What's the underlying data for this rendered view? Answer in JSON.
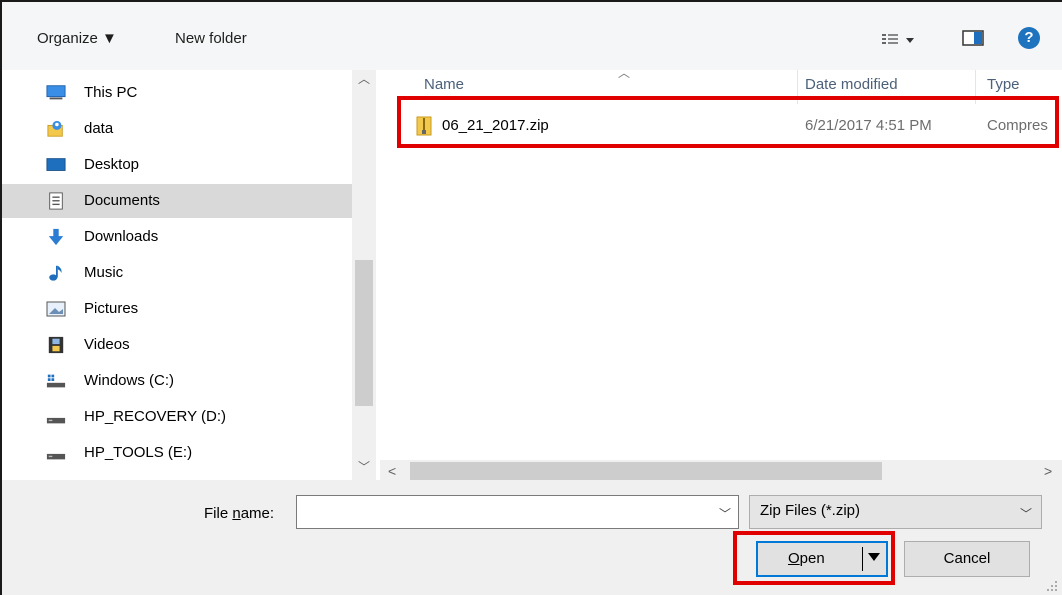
{
  "toolbar": {
    "organize_label": "Organize ▼",
    "new_folder_label": "New folder",
    "view_icon": "view-options-icon",
    "preview_icon": "preview-pane-icon",
    "help_icon": "help-icon",
    "help_glyph": "?"
  },
  "nav": {
    "items": [
      {
        "label": "This PC",
        "icon": "computer-icon"
      },
      {
        "label": "data",
        "icon": "user-folder-icon"
      },
      {
        "label": "Desktop",
        "icon": "desktop-icon"
      },
      {
        "label": "Documents",
        "icon": "documents-icon",
        "selected": true
      },
      {
        "label": "Downloads",
        "icon": "download-arrow-icon"
      },
      {
        "label": "Music",
        "icon": "music-note-icon"
      },
      {
        "label": "Pictures",
        "icon": "pictures-icon"
      },
      {
        "label": "Videos",
        "icon": "film-icon"
      },
      {
        "label": "Windows (C:)",
        "icon": "windows-drive-icon"
      },
      {
        "label": "HP_RECOVERY (D:)",
        "icon": "drive-icon"
      },
      {
        "label": "HP_TOOLS (E:)",
        "icon": "drive-icon"
      }
    ]
  },
  "files": {
    "columns": [
      "Name",
      "Date modified",
      "Type"
    ],
    "rows": [
      {
        "name": "06_21_2017.zip",
        "date": "6/21/2017 4:51 PM",
        "type": "Compres",
        "icon": "zip-folder-icon"
      }
    ]
  },
  "bottom": {
    "file_name_label_pre": "File ",
    "file_name_label_accel": "n",
    "file_name_label_post": "ame:",
    "file_name_value": "",
    "file_type_value": "Zip Files (*.zip)",
    "open_accel": "O",
    "open_rest": "pen",
    "cancel_label": "Cancel"
  },
  "colors": {
    "highlight": "#e00000",
    "selected_nav": "#d9d9d9",
    "default_button_border": "#0078d7",
    "help_blue": "#1e73be"
  }
}
